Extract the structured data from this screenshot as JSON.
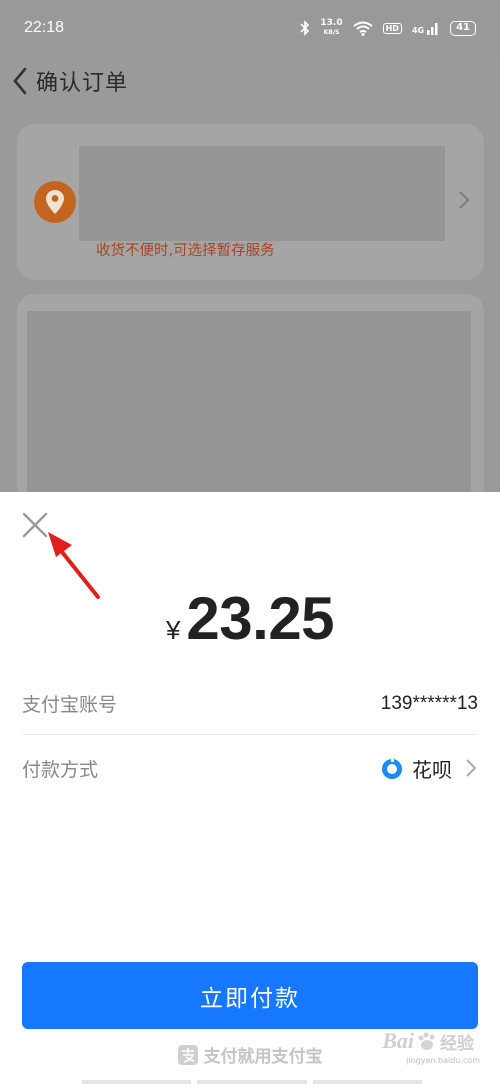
{
  "status_bar": {
    "time": "22:18",
    "net_speed_value": "13.0",
    "net_speed_unit": "KB/S",
    "hd": "HD",
    "signal": "4G",
    "battery": "41"
  },
  "header": {
    "title": "确认订单"
  },
  "address_card": {
    "tip": "收货不便时,可选择暂存服务"
  },
  "payment_sheet": {
    "currency_symbol": "¥",
    "amount": "23.25",
    "account_label": "支付宝账号",
    "account_value": "139******13",
    "method_label": "付款方式",
    "method_value": "花呗",
    "pay_button_label": "立即付款",
    "footer_brand": "支付就用支付宝"
  },
  "watermark": {
    "text": "Bai",
    "suffix": "经验",
    "url": "jingyan.baidu.com"
  },
  "colors": {
    "primary_blue": "#1677ff",
    "tip_orange": "#a94421",
    "annotation_red": "#e0201b"
  },
  "icons": [
    "back-icon",
    "location-icon",
    "chevron-right-icon",
    "close-icon",
    "huabei-icon",
    "alipay-brand-icon",
    "bluetooth-icon",
    "wifi-icon",
    "signal-icon"
  ]
}
